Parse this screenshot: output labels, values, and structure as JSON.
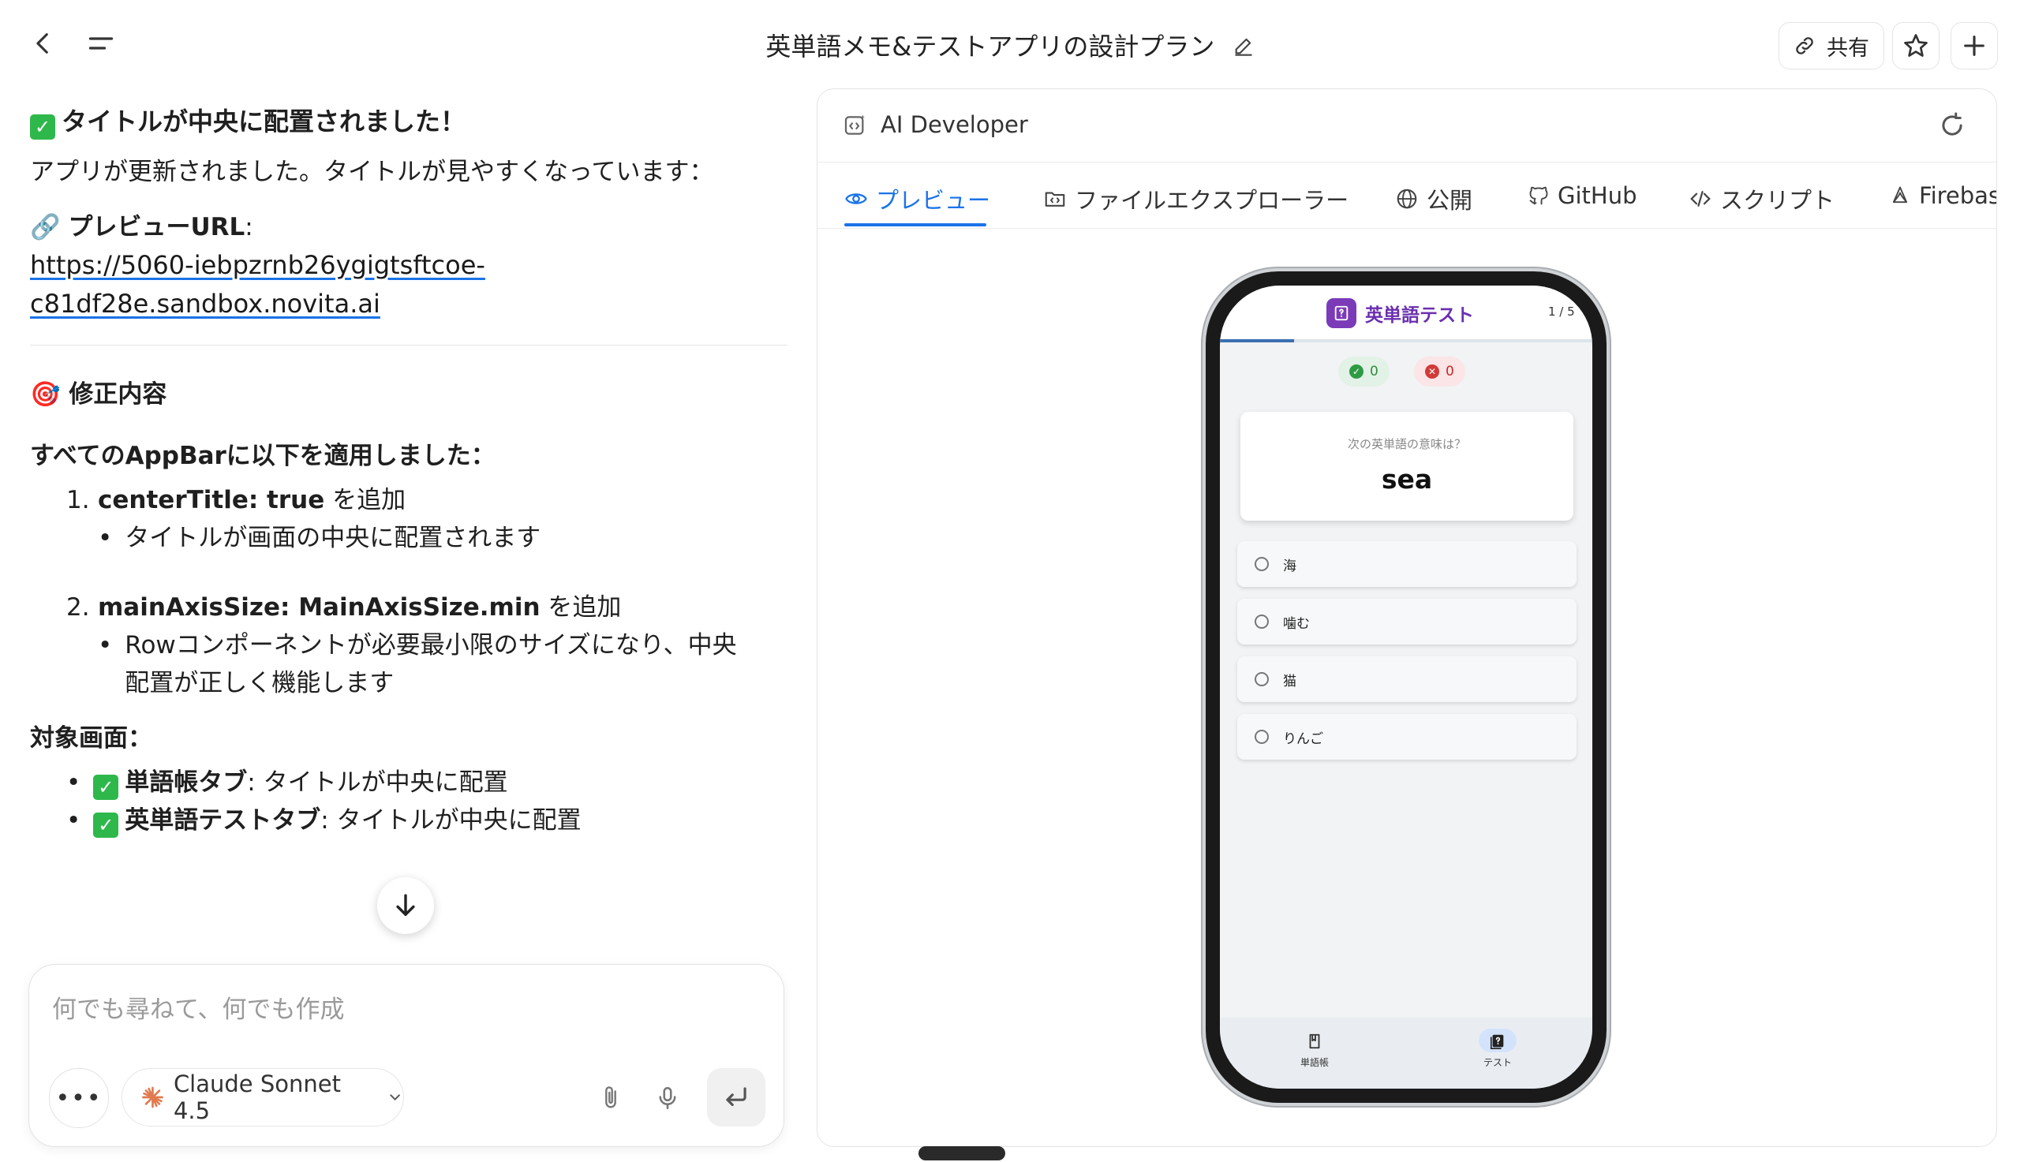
{
  "header": {
    "title": "英単語メモ&テストアプリの設計プラン",
    "share_label": "共有",
    "back_icon": "chevron-left-icon",
    "menu_icon": "menu-icon",
    "star_icon": "star-icon",
    "new_icon": "plus-icon"
  },
  "chat": {
    "heading": "タイトルが中央に配置されました！",
    "updated_text": "アプリが更新されました。タイトルが見やすくなっています：",
    "preview_label": "プレビューURL",
    "preview_colon": ":",
    "preview_url": "https://5060-iebpzrnb26ygigtsftcoe-c81df28e.sandbox.novita.ai",
    "fix_heading": "修正内容",
    "applied_heading": "すべてのAppBarに以下を適用しました：",
    "items": [
      {
        "num": "1.",
        "code": "centerTitle: true",
        "suffix": " を追加",
        "bullet": "タイトルが画面の中央に配置されます"
      },
      {
        "num": "2.",
        "code": "mainAxisSize: MainAxisSize.min",
        "suffix": " を追加",
        "bullet": "Rowコンポーネントが必要最小限のサイズになり、中央配置が正しく機能します"
      }
    ],
    "target_heading": "対象画面：",
    "targets": [
      {
        "name": "単語帳タブ",
        "desc": ": タイトルが中央に配置"
      },
      {
        "name": "英単語テストタブ",
        "desc": ": タイトルが中央に配置"
      }
    ]
  },
  "composer": {
    "placeholder": "何でも尋ねて、何でも作成",
    "model": "Claude Sonnet 4.5"
  },
  "panel": {
    "title": "AI Developer",
    "tabs": [
      {
        "label": "プレビュー",
        "icon": "eye-icon",
        "active": true
      },
      {
        "label": "ファイルエクスプローラー",
        "icon": "folder-code-icon",
        "active": false
      },
      {
        "label": "公開",
        "icon": "globe-icon",
        "active": false
      },
      {
        "label": "GitHub",
        "icon": "github-icon",
        "active": false
      },
      {
        "label": "スクリプト",
        "icon": "code-icon",
        "active": false
      },
      {
        "label": "Firebas",
        "icon": "firebase-icon",
        "active": false
      }
    ]
  },
  "phone_app": {
    "title": "英単語テスト",
    "counter": "1 / 5",
    "progress": 0.2,
    "correct": "0",
    "wrong": "0",
    "prompt": "次の英単語の意味は？",
    "word": "sea",
    "options": [
      "海",
      "噛む",
      "猫",
      "りんご"
    ],
    "nav": [
      {
        "label": "単語帳",
        "icon": "book-icon"
      },
      {
        "label": "テスト",
        "icon": "quiz-icon",
        "active": true
      }
    ]
  },
  "colors": {
    "accent": "#1a73e8",
    "check": "#2eb84b",
    "app_purple": "#7b3bb8"
  }
}
